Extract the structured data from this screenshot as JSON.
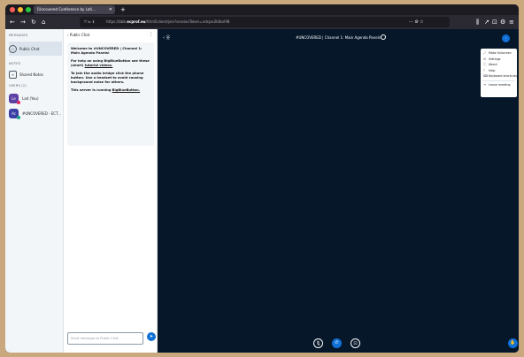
{
  "browser": {
    "tab_title": "[Uncovered Conference by Lati...",
    "tab_close": "✕",
    "new_tab": "+",
    "url_prefix": "https://bbb.",
    "url_domain": "ecprof.eu",
    "url_rest": "/html5client/join?sessionToken=ndsjxe2k8ssl98",
    "url_prefix_icons": "⛉ ⇆ ⬍",
    "url_right_icons": "··· ⊘ ☆",
    "nav_back": "←",
    "nav_forward": "→",
    "nav_reload": "↻",
    "nav_home": "⌂",
    "toolbar_icons": [
      "⫼",
      "↗",
      "⊡",
      "⚙",
      "≡"
    ]
  },
  "userlist": {
    "messages_title": "MESSAGES",
    "public_chat_label": "Public Chat",
    "notes_title": "NOTES",
    "shared_notes_label": "Shared Notes",
    "users_title": "USERS (2)",
    "users": [
      {
        "initials": "Le",
        "name": "Lad (You)",
        "color": "#5c3fa3",
        "badge_color": "#e0245e"
      },
      {
        "initials": "Ac",
        "name": "#UNCOVERED - ECT...",
        "color": "#3b3fa3",
        "badge_color": "#17a589"
      }
    ]
  },
  "chat": {
    "header_label": "‹ Public Chat",
    "kebab": "⋮",
    "welcome_title": "Welcome to #UNCOVERED | Channel 1: Main Agenda Panels!",
    "help_prefix": "For help on using BigBlueButton see these (short) ",
    "help_link": "tutorial videos.",
    "audio_text": "To join the audio bridge click the phone button. Use a headset to avoid causing background noise for others.",
    "running_prefix": "This server is running ",
    "running_link": "BigBlueButton.",
    "input_placeholder": "Send message to Public Chat",
    "send_icon": "➤"
  },
  "presentation": {
    "title": "#UNCOVERED | Channel 1: Main Agenda Panels",
    "userlist_toggle": "‹ 웃",
    "options_label": "⋮"
  },
  "options_menu": {
    "items": [
      {
        "icon": "⤢",
        "label": "Make fullscreen"
      },
      {
        "icon": "⚙",
        "label": "Settings"
      },
      {
        "icon": "ⓘ",
        "label": "About"
      },
      {
        "icon": "?",
        "label": "Help"
      },
      {
        "icon": "⌨",
        "label": "Keyboard shortcuts"
      }
    ],
    "leave": {
      "icon": "⇥",
      "label": "Leave meeting"
    }
  },
  "controls": {
    "mute_icon": "🎙",
    "phone_icon": "✆",
    "camera_icon": "⊡",
    "raise_icon": "✋"
  },
  "colors": {
    "accent": "#0f70d7",
    "background": "#06172a",
    "sidebar": "#f3f6f9"
  }
}
